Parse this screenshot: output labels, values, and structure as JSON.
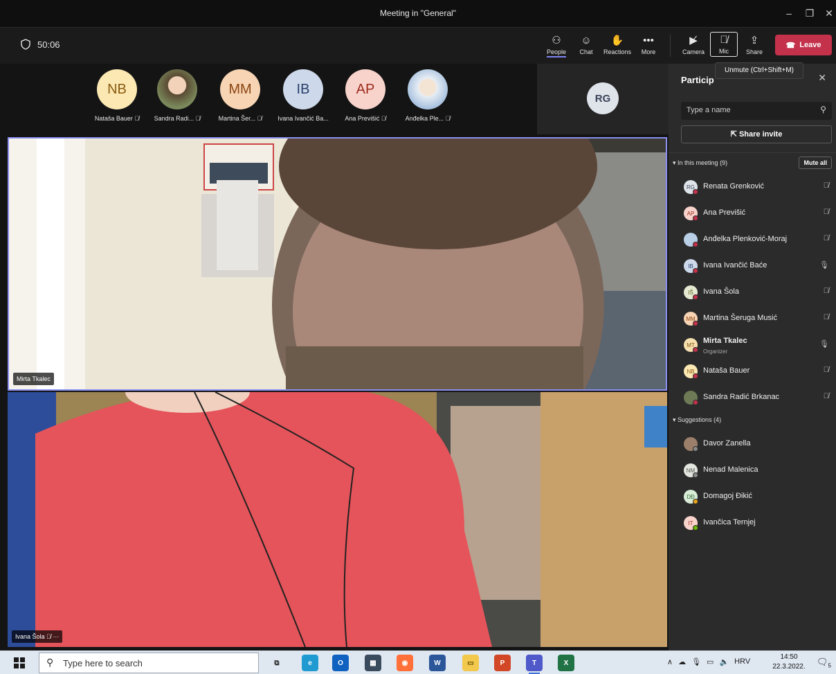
{
  "window": {
    "title": "Meeting in \"General\"",
    "controls": [
      "minimize-icon",
      "maximize-icon",
      "close-icon"
    ]
  },
  "toolbar": {
    "timer": "50:06",
    "buttons": [
      {
        "label": "People",
        "icon": "people-icon",
        "active": true
      },
      {
        "label": "Chat",
        "icon": "chat-icon"
      },
      {
        "label": "Reactions",
        "icon": "reactions-icon"
      },
      {
        "label": "More",
        "icon": "more-icon"
      },
      {
        "label": "Camera",
        "icon": "camera-off-icon"
      },
      {
        "label": "Mic",
        "icon": "mic-off-icon"
      },
      {
        "label": "Share",
        "icon": "share-icon"
      }
    ],
    "leave_label": "Leave",
    "tooltip": "Unmute (Ctrl+Shift+M)"
  },
  "stage": {
    "avatars": [
      {
        "initials": "NB",
        "name": "Nataša Bauer",
        "bg": "#fbe8b3",
        "fg": "#8a5a10"
      },
      {
        "initials": "",
        "name": "Sandra Radi...",
        "bg": "#6d7a55",
        "fg": "#fff"
      },
      {
        "initials": "MM",
        "name": "Martina Šer...",
        "bg": "#f7d4b3",
        "fg": "#8b4513"
      },
      {
        "initials": "IB",
        "name": "Ivana Ivančić Ba...",
        "bg": "#cdd8ea",
        "fg": "#29406b"
      },
      {
        "initials": "AP",
        "name": "Ana Previšić",
        "bg": "#f8d3cc",
        "fg": "#9d2b1c"
      },
      {
        "initials": "",
        "name": "Anđelka Ple...",
        "bg": "#b9cfe6",
        "fg": "#fff"
      }
    ],
    "rg_initials": "RG",
    "video_main_name": "Mirta Tkalec",
    "video_second_name": "Ivana Šola"
  },
  "panel": {
    "title": "Particip",
    "search_placeholder": "Type a name",
    "share_invite_label": "Share invite",
    "in_meeting_label": "In this meeting (9)",
    "mute_all_label": "Mute all",
    "participants": [
      {
        "initials": "RG",
        "name": "Renata Grenković",
        "bg": "#dfe3ea",
        "fg": "#3a4458",
        "mic": "off"
      },
      {
        "initials": "AP",
        "name": "Ana Previšić",
        "bg": "#f8d3cc",
        "fg": "#9d2b1c",
        "mic": "off"
      },
      {
        "initials": "",
        "name": "Anđelka Plenković-Moraj",
        "bg": "#b9cfe6",
        "fg": "#fff",
        "mic": "off"
      },
      {
        "initials": "IB",
        "name": "Ivana Ivančić Baće",
        "bg": "#cdd8ea",
        "fg": "#29406b",
        "mic": "on"
      },
      {
        "initials": "IŠ",
        "name": "Ivana Šola",
        "bg": "#e6ead2",
        "fg": "#58601d",
        "mic": "off"
      },
      {
        "initials": "MM",
        "name": "Martina Šeruga Musić",
        "bg": "#f7d4b3",
        "fg": "#8b4513",
        "mic": "off"
      },
      {
        "initials": "MT",
        "name": "Mirta Tkalec",
        "sub": "Organizer",
        "bg": "#f7e0b0",
        "fg": "#7a5210",
        "mic": "on"
      },
      {
        "initials": "NB",
        "name": "Nataša Bauer",
        "bg": "#fbe8b3",
        "fg": "#8a5a10",
        "mic": "off"
      },
      {
        "initials": "",
        "name": "Sandra Radić Brkanac",
        "bg": "#6d7a55",
        "fg": "#fff",
        "mic": "off"
      }
    ],
    "suggestions_label": "Suggestions (4)",
    "suggestions": [
      {
        "initials": "",
        "name": "Davor Zanella",
        "bg": "#9c7f6a",
        "fg": "#fff",
        "status": "#8a8a8a"
      },
      {
        "initials": "NM",
        "name": "Nenad Malenica",
        "bg": "#e3e5df",
        "fg": "#4d554a",
        "status": "#8a8a8a"
      },
      {
        "initials": "DĐ",
        "name": "Domagoj Đikić",
        "bg": "#d8ecd7",
        "fg": "#2f6b34",
        "status": "#e8a317"
      },
      {
        "initials": "IT",
        "name": "Ivančica Ternjej",
        "bg": "#f8d3cc",
        "fg": "#9d2b1c",
        "status": "#6bb700"
      }
    ]
  },
  "taskbar": {
    "search_placeholder": "Type here to search",
    "time": "14:50",
    "date": "22.3.2022.",
    "language": "HRV",
    "notifications": "5",
    "apps": [
      {
        "name": "task-view",
        "bg": "#dfe7f1",
        "fg": "#222",
        "text": "⧉"
      },
      {
        "name": "edge",
        "bg": "#1f9bd1",
        "fg": "#fff",
        "text": "e"
      },
      {
        "name": "outlook",
        "bg": "#0f62c0",
        "fg": "#fff",
        "text": "O"
      },
      {
        "name": "calculator",
        "bg": "#3b4b5e",
        "fg": "#fff",
        "text": "▦"
      },
      {
        "name": "firefox",
        "bg": "#ff7139",
        "fg": "#fff",
        "text": "◉"
      },
      {
        "name": "word",
        "bg": "#2b579a",
        "fg": "#fff",
        "text": "W"
      },
      {
        "name": "file-explorer",
        "bg": "#f2c94c",
        "fg": "#5a4300",
        "text": "▭"
      },
      {
        "name": "powerpoint",
        "bg": "#d24726",
        "fg": "#fff",
        "text": "P"
      },
      {
        "name": "teams",
        "bg": "#5059c9",
        "fg": "#fff",
        "text": "T"
      },
      {
        "name": "excel",
        "bg": "#217346",
        "fg": "#fff",
        "text": "X"
      }
    ]
  }
}
